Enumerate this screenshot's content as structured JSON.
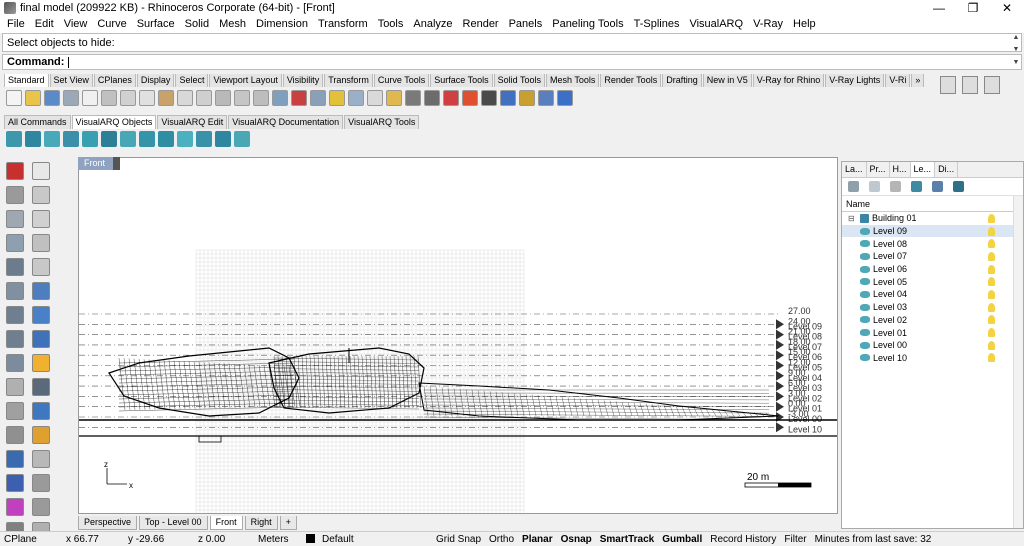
{
  "window": {
    "title": "final model (209922 KB) - Rhinoceros Corporate (64-bit) - [Front]",
    "minimize": "—",
    "restore": "❐",
    "close": "✕"
  },
  "menu": [
    "File",
    "Edit",
    "View",
    "Curve",
    "Surface",
    "Solid",
    "Mesh",
    "Dimension",
    "Transform",
    "Tools",
    "Analyze",
    "Render",
    "Panels",
    "Paneling Tools",
    "T-Splines",
    "VisualARQ",
    "V-Ray",
    "Help"
  ],
  "command": {
    "history": "Select objects to hide:",
    "label": "Command:",
    "value": ""
  },
  "toolbar_tabs": [
    "Standard",
    "Set View",
    "CPlanes",
    "Display",
    "Select",
    "Viewport Layout",
    "Visibility",
    "Transform",
    "Curve Tools",
    "Surface Tools",
    "Solid Tools",
    "Mesh Tools",
    "Render Tools",
    "Drafting",
    "New in V5",
    "V-Ray for Rhino",
    "V-Ray Lights",
    "V-Ri",
    "»"
  ],
  "arq_tabs": [
    "All Commands",
    "VisualARQ Objects",
    "VisualARQ Edit",
    "VisualARQ Documentation",
    "VisualARQ Tools"
  ],
  "viewport": {
    "name": "Front",
    "axis_z": "z",
    "axis_x": "x",
    "scale_label": "20 m",
    "elevations": [
      {
        "value": "27.00",
        "level": ""
      },
      {
        "value": "24.00",
        "level": "Level 09"
      },
      {
        "value": "21.00",
        "level": "Level 08"
      },
      {
        "value": "18.00",
        "level": "Level 07"
      },
      {
        "value": "15.00",
        "level": "Level 06"
      },
      {
        "value": "12.00",
        "level": "Level 05"
      },
      {
        "value": "9.00",
        "level": "Level 04"
      },
      {
        "value": "6.00",
        "level": "Level 03"
      },
      {
        "value": "3.00",
        "level": "Level 02"
      },
      {
        "value": "0.00",
        "level": "Level 01"
      },
      {
        "value": "-3.00",
        "level": "Level 00"
      },
      {
        "value": "",
        "level": "Level 10"
      }
    ]
  },
  "viewport_tabs": [
    "Perspective",
    "Top - Level 00",
    "Front",
    "Right",
    "+"
  ],
  "panel": {
    "tabs": [
      "La...",
      "Pr...",
      "H...",
      "Le...",
      "Di..."
    ],
    "col_name": "Name",
    "col_extra": "E",
    "root": "Building 01",
    "levels": [
      "Level 09",
      "Level 08",
      "Level 07",
      "Level 06",
      "Level 05",
      "Level 04",
      "Level 03",
      "Level 02",
      "Level 01",
      "Level 00",
      "Level 10"
    ],
    "selected_index": 0
  },
  "status": {
    "cplane": "CPlane",
    "x": "x 66.77",
    "y": "y -29.66",
    "z": "z 0.00",
    "units": "Meters",
    "layer": "Default",
    "grid_snap": "Grid Snap",
    "ortho": "Ortho",
    "planar": "Planar",
    "osnap": "Osnap",
    "smarttrack": "SmartTrack",
    "gumball": "Gumball",
    "record_history": "Record History",
    "filter": "Filter",
    "minutes": "Minutes from last save: 32"
  }
}
